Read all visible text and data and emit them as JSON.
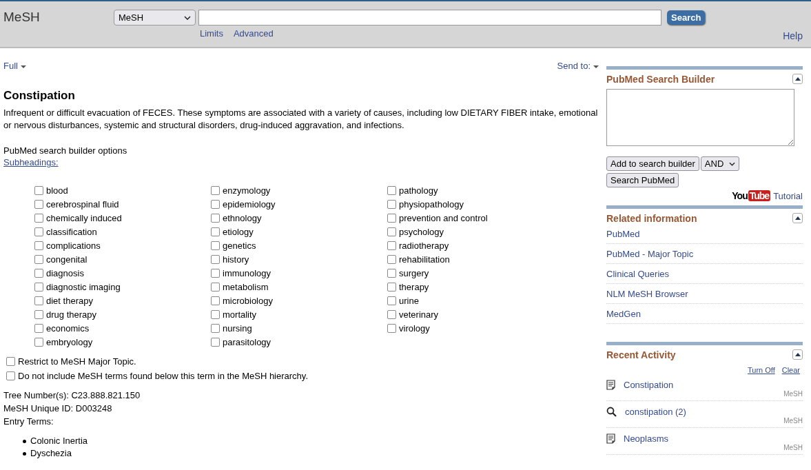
{
  "header": {
    "site_title": "MeSH",
    "database_select": "MeSH",
    "search_button": "Search",
    "links": [
      "Limits",
      "Advanced"
    ],
    "help": "Help"
  },
  "toolbar": {
    "format": "Full",
    "send_to": "Send to:"
  },
  "term": {
    "title": "Constipation",
    "description": "Infrequent or difficult evacuation of FECES. These symptoms are associated with a variety of causes, including low DIETARY FIBER intake, emotional or nervous disturbances, systemic and structural disorders, drug-induced aggravation, and infections."
  },
  "options_label": "PubMed search builder options",
  "subheadings_link": "Subheadings:",
  "subheadings": [
    {
      "label": "blood",
      "checked": false
    },
    {
      "label": "cerebrospinal fluid",
      "checked": false
    },
    {
      "label": "chemically induced",
      "checked": false
    },
    {
      "label": "classification",
      "checked": false
    },
    {
      "label": "complications",
      "checked": false
    },
    {
      "label": "congenital",
      "checked": false
    },
    {
      "label": "diagnosis",
      "checked": false
    },
    {
      "label": "diagnostic imaging",
      "checked": false
    },
    {
      "label": "diet therapy",
      "checked": false
    },
    {
      "label": "drug therapy",
      "checked": false
    },
    {
      "label": "economics",
      "checked": false
    },
    {
      "label": "embryology",
      "checked": false
    },
    {
      "label": "enzymology",
      "checked": false
    },
    {
      "label": "epidemiology",
      "checked": false
    },
    {
      "label": "ethnology",
      "checked": false
    },
    {
      "label": "etiology",
      "checked": false
    },
    {
      "label": "genetics",
      "checked": false
    },
    {
      "label": "history",
      "checked": false
    },
    {
      "label": "immunology",
      "checked": false
    },
    {
      "label": "metabolism",
      "checked": false
    },
    {
      "label": "microbiology",
      "checked": false
    },
    {
      "label": "mortality",
      "checked": false
    },
    {
      "label": "nursing",
      "checked": false
    },
    {
      "label": "parasitology",
      "checked": false
    },
    {
      "label": "pathology",
      "checked": false
    },
    {
      "label": "physiopathology",
      "checked": false
    },
    {
      "label": "prevention and control",
      "checked": false
    },
    {
      "label": "psychology",
      "checked": false
    },
    {
      "label": "radiotherapy",
      "checked": false
    },
    {
      "label": "rehabilitation",
      "checked": false
    },
    {
      "label": "surgery",
      "checked": false
    },
    {
      "label": "therapy",
      "checked": false
    },
    {
      "label": "urine",
      "checked": false
    },
    {
      "label": "veterinary",
      "checked": false
    },
    {
      "label": "virology",
      "checked": false
    }
  ],
  "restrictions": [
    {
      "label": "Restrict to MeSH Major Topic.",
      "checked": false
    },
    {
      "label": "Do not include MeSH terms found below this term in the MeSH hierarchy.",
      "checked": false
    }
  ],
  "details": [
    "Tree Number(s): C23.888.821.150",
    "MeSH Unique ID: D003248",
    "Entry Terms:"
  ],
  "entry_terms": [
    "Colonic Inertia",
    "Dyschezia"
  ],
  "search_builder": {
    "title": "PubMed Search Builder",
    "add_button": "Add to search builder",
    "operator": "AND",
    "search_button": "Search PubMed",
    "logo": [
      "You",
      "Tube"
    ],
    "tutorial": "Tutorial"
  },
  "related": {
    "title": "Related information",
    "links": [
      "PubMed",
      "PubMed - Major Topic",
      "Clinical Queries",
      "NLM MeSH Browser",
      "MedGen"
    ]
  },
  "recent": {
    "title": "Recent Activity",
    "actions": [
      "Turn Off",
      "Clear"
    ],
    "items": [
      {
        "kind": "record",
        "label": "Constipation",
        "source": "MeSH"
      },
      {
        "kind": "search",
        "label": "constipation (2)",
        "source": "MeSH"
      },
      {
        "kind": "record",
        "label": "Neoplasms",
        "source": "MeSH"
      }
    ]
  }
}
